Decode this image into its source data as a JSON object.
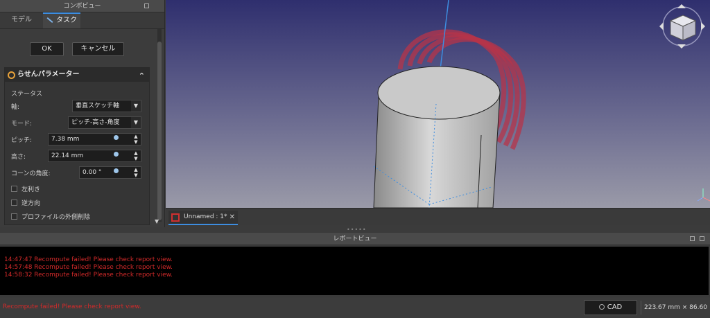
{
  "combo": {
    "title": "コンボビュー",
    "tabs": [
      {
        "label": "モデル",
        "active": false
      },
      {
        "label": "タスク",
        "active": true
      }
    ],
    "ok_label": "OK",
    "cancel_label": "キャンセル",
    "panel_title": "らせんパラメーター",
    "status_label": "ステータス",
    "axis_label": "軸:",
    "axis_value": "垂直スケッチ軸",
    "mode_label": "モード:",
    "mode_value": "ピッチ-高さ-角度",
    "pitch_label": "ピッチ:",
    "pitch_value": "7.38 mm",
    "height_label": "高さ:",
    "height_value": "22.14 mm",
    "cone_label": "コーンの角度:",
    "cone_value": "0.00 °",
    "left_handed_label": "左利き",
    "reversed_label": "逆方向",
    "remove_outside_label": "プロファイルの外側削除"
  },
  "document_tab": {
    "label": "Unnamed : 1*"
  },
  "report": {
    "title": "レポートビュー",
    "lines": [
      "14:47:47  Recompute failed! Please check report view.",
      "14:57:48  Recompute failed! Please check report view.",
      "14:58:32  Recompute failed! Please check report view."
    ]
  },
  "status": {
    "message": "Recompute failed! Please check report view.",
    "nav_style": "CAD",
    "dimensions": "223.67 mm × 86.60 mm"
  },
  "colors": {
    "accent": "#3d8de0",
    "error": "#d42a2a",
    "helix": "#b5344a"
  }
}
